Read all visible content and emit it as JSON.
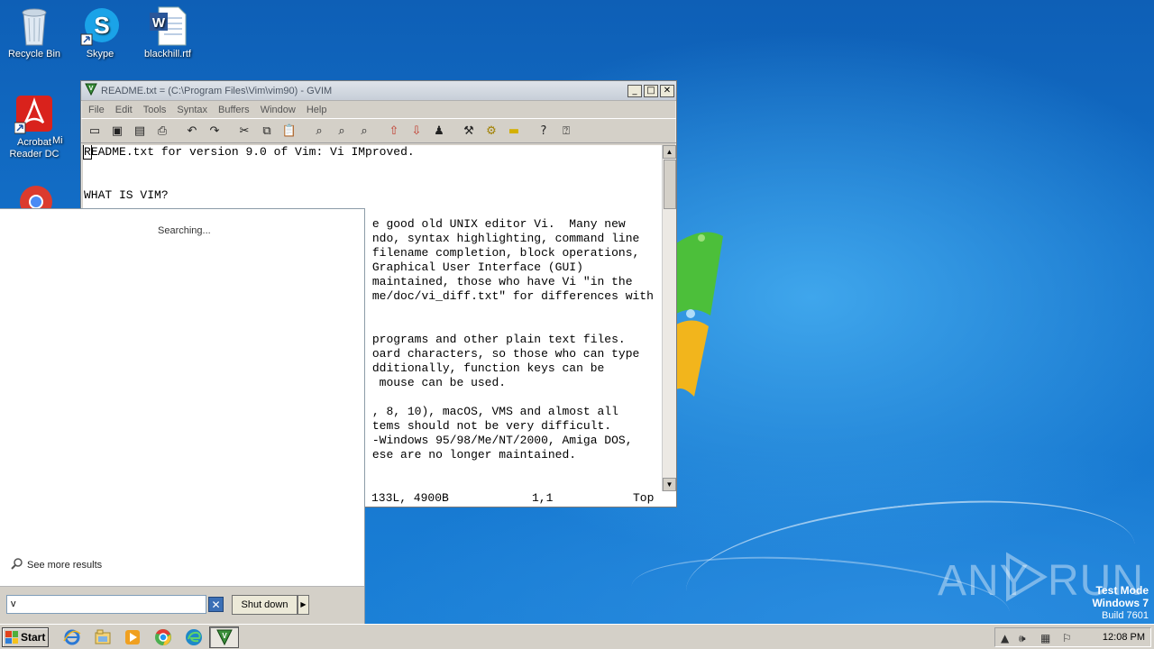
{
  "desktop": {
    "icons": [
      {
        "label": "Recycle Bin"
      },
      {
        "label": "Skype"
      },
      {
        "label": "blackhill.rtf"
      },
      {
        "label": "Acrobat Reader DC"
      },
      {
        "label": "Mi"
      }
    ]
  },
  "gvim": {
    "title": "README.txt = (C:\\Program Files\\Vim\\vim90) - GVIM",
    "menu": [
      "File",
      "Edit",
      "Tools",
      "Syntax",
      "Buffers",
      "Window",
      "Help"
    ],
    "toolbar_icons": [
      "open-icon",
      "save-icon",
      "save-all-icon",
      "print-icon",
      "undo-icon",
      "redo-icon",
      "cut-icon",
      "copy-icon",
      "paste-icon",
      "find-replace-icon",
      "find-next-icon",
      "find-prev-icon",
      "load-session-icon",
      "save-session-icon",
      "run-script-icon",
      "make-icon",
      "run-shell-icon",
      "tags-icon",
      "help-icon",
      "find-help-icon"
    ],
    "lines": [
      "README.txt for version 9.0 of Vim: Vi IMproved.",
      "",
      "",
      "WHAT IS VIM?",
      "",
      "                                         e good old UNIX editor Vi.  Many new",
      "                                         ndo, syntax highlighting, command line",
      "                                         filename completion, block operations,",
      "                                         Graphical User Interface (GUI)",
      "                                         maintained, those who have Vi \"in the",
      "                                         me/doc/vi_diff.txt\" for differences with",
      "",
      "",
      "                                         programs and other plain text files.",
      "                                         oard characters, so those who can type",
      "                                         dditionally, function keys can be",
      "                                          mouse can be used.",
      "",
      "                                         , 8, 10), macOS, VMS and almost all",
      "                                         tems should not be very difficult.",
      "                                         -Windows 95/98/Me/NT/2000, Amiga DOS,",
      "                                         ese are no longer maintained."
    ],
    "status": {
      "size": "133L, 4900B",
      "position": "1,1",
      "scroll": "Top"
    }
  },
  "startmenu": {
    "searching": "Searching...",
    "see_more": "See more results",
    "search_value": "v",
    "shutdown": "Shut down"
  },
  "watermark": {
    "brand": "ANY RUN"
  },
  "testmode": {
    "line1": "Test Mode",
    "line2": "Windows 7",
    "line3": "Build 7601"
  },
  "taskbar": {
    "start": "Start",
    "pinned": [
      "internet-explorer-icon",
      "explorer-icon",
      "media-player-icon",
      "chrome-icon",
      "edge-icon",
      "gvim-icon"
    ],
    "clock": "12:08 PM"
  },
  "colors": {
    "desktop_blue": "#1370c9",
    "taskbar": "#d4d0c8",
    "start_menu_bg": "#ffffff"
  }
}
